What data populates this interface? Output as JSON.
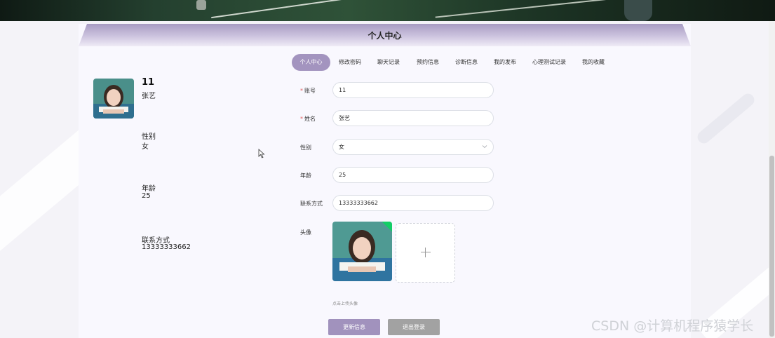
{
  "panel": {
    "title": "个人中心"
  },
  "profile": {
    "id": "11",
    "name": "张艺",
    "info": [
      {
        "label": "性别",
        "value": "女"
      },
      {
        "label": "年龄",
        "value": "25"
      },
      {
        "label": "联系方式",
        "value": "13333333662"
      }
    ]
  },
  "tabs": [
    {
      "label": "个人中心",
      "active": true
    },
    {
      "label": "修改密码",
      "active": false
    },
    {
      "label": "聊天记录",
      "active": false
    },
    {
      "label": "预约信息",
      "active": false
    },
    {
      "label": "诊断信息",
      "active": false
    },
    {
      "label": "我的发布",
      "active": false
    },
    {
      "label": "心理测试记录",
      "active": false
    },
    {
      "label": "我的收藏",
      "active": false
    }
  ],
  "form": {
    "account": {
      "label": "账号",
      "value": "11",
      "required": true
    },
    "name": {
      "label": "姓名",
      "value": "张艺",
      "required": true
    },
    "gender": {
      "label": "性别",
      "value": "女"
    },
    "age": {
      "label": "年龄",
      "value": "25"
    },
    "phone": {
      "label": "联系方式",
      "value": "13333333662"
    },
    "avatar": {
      "label": "头像",
      "hint": "点击上传头像"
    }
  },
  "buttons": {
    "update": "更新信息",
    "logout": "退出登录"
  },
  "watermark": "CSDN @计算机程序猿学长",
  "colors": {
    "accent": "#a394bf",
    "required": "#e05a5a",
    "success_badge": "#13ce66"
  }
}
